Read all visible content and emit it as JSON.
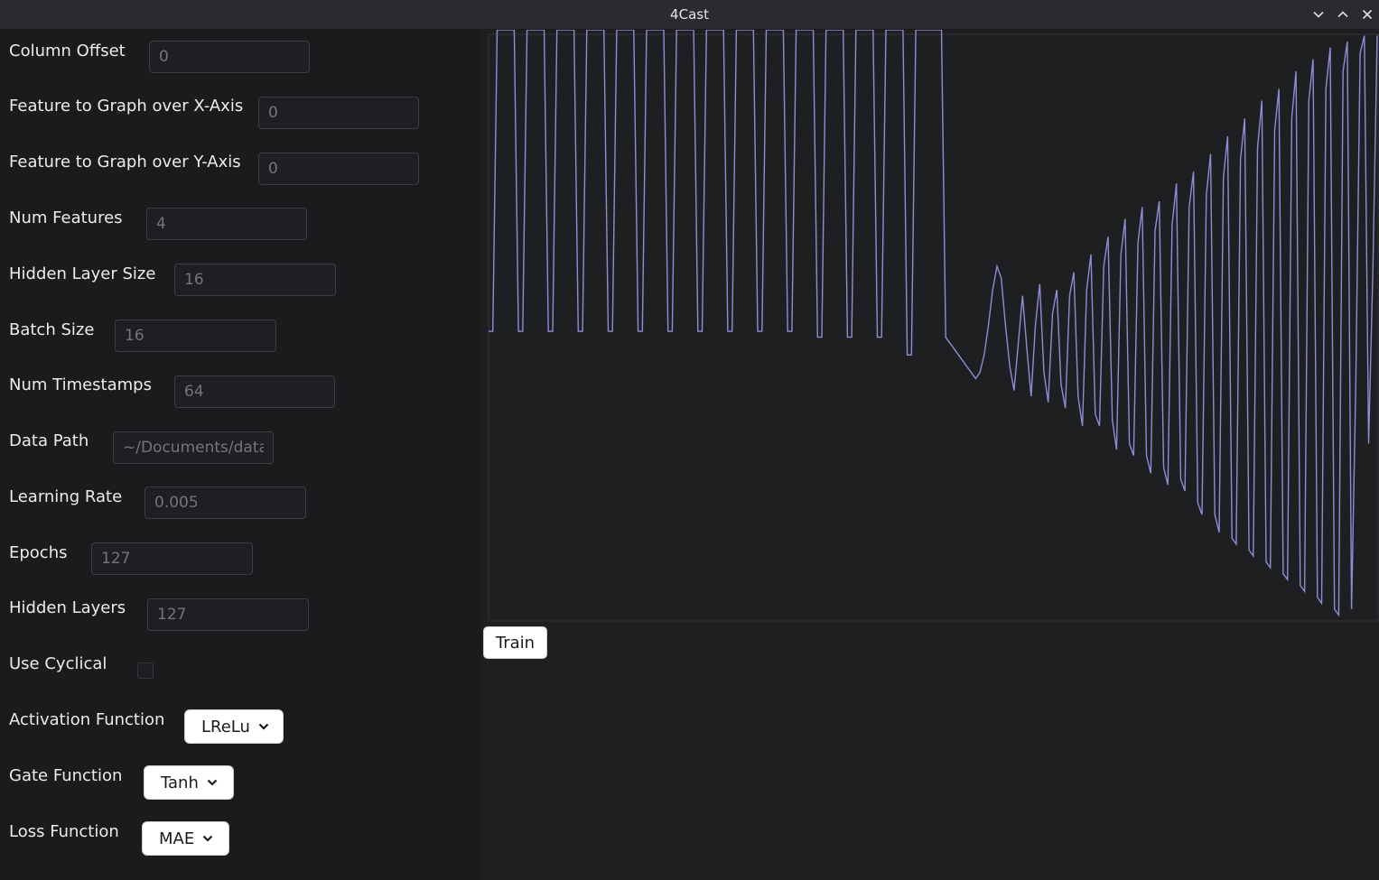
{
  "window": {
    "title": "4Cast"
  },
  "form": {
    "column_offset": {
      "label": "Column Offset",
      "placeholder": "0"
    },
    "feature_x": {
      "label": "Feature to Graph over X-Axis",
      "placeholder": "0"
    },
    "feature_y": {
      "label": "Feature to Graph over Y-Axis",
      "placeholder": "0"
    },
    "num_features": {
      "label": "Num Features",
      "placeholder": "4"
    },
    "hidden_layer_size": {
      "label": "Hidden Layer Size",
      "placeholder": "16"
    },
    "batch_size": {
      "label": "Batch Size",
      "placeholder": "16"
    },
    "num_timestamps": {
      "label": "Num Timestamps",
      "placeholder": "64"
    },
    "data_path": {
      "label": "Data Path",
      "placeholder": "~/Documents/data."
    },
    "learning_rate": {
      "label": "Learning Rate",
      "placeholder": "0.005"
    },
    "epochs": {
      "label": "Epochs",
      "placeholder": "127"
    },
    "hidden_layers": {
      "label": "Hidden Layers",
      "placeholder": "127"
    },
    "use_cyclical": {
      "label": "Use Cyclical",
      "checked": false
    },
    "activation_function": {
      "label": "Activation Function",
      "value": "LReLu"
    },
    "gate_function": {
      "label": "Gate Function",
      "value": "Tanh"
    },
    "loss_function": {
      "label": "Loss Function",
      "value": "MAE"
    }
  },
  "actions": {
    "train_label": "Train"
  },
  "colors": {
    "line": "#8f8cd6",
    "frame": "#2c2d31"
  },
  "chart_data": {
    "type": "line",
    "title": "",
    "xlabel": "",
    "ylabel": "",
    "grid": false,
    "legend": false,
    "xlim": [
      0,
      260
    ],
    "ylim": [
      0,
      1
    ],
    "series": [
      {
        "values": [
          0.49,
          0.49,
          1.0,
          1.0,
          1.0,
          1.0,
          1.0,
          0.49,
          0.49,
          1.0,
          1.0,
          1.0,
          1.0,
          1.0,
          0.49,
          0.49,
          1.0,
          1.0,
          1.0,
          1.0,
          1.0,
          0.49,
          0.49,
          1.0,
          1.0,
          1.0,
          1.0,
          1.0,
          0.49,
          0.49,
          1.0,
          1.0,
          1.0,
          1.0,
          1.0,
          0.49,
          0.49,
          1.0,
          1.0,
          1.0,
          1.0,
          1.0,
          0.49,
          0.49,
          1.0,
          1.0,
          1.0,
          1.0,
          1.0,
          0.49,
          0.49,
          1.0,
          1.0,
          1.0,
          1.0,
          1.0,
          0.49,
          0.49,
          1.0,
          1.0,
          1.0,
          1.0,
          1.0,
          0.49,
          0.49,
          1.0,
          1.0,
          1.0,
          1.0,
          1.0,
          0.49,
          0.49,
          1.0,
          1.0,
          1.0,
          1.0,
          1.0,
          0.48,
          0.48,
          1.0,
          1.0,
          1.0,
          1.0,
          1.0,
          0.48,
          0.48,
          1.0,
          1.0,
          1.0,
          1.0,
          1.0,
          0.48,
          0.48,
          1.0,
          1.0,
          1.0,
          1.0,
          1.0,
          0.45,
          0.45,
          1.0,
          1.0,
          1.0,
          1.0,
          1.0,
          1.0,
          1.0,
          0.48,
          0.47,
          0.46,
          0.45,
          0.44,
          0.43,
          0.42,
          0.41,
          0.42,
          0.45,
          0.5,
          0.56,
          0.6,
          0.58,
          0.5,
          0.43,
          0.39,
          0.47,
          0.55,
          0.46,
          0.38,
          0.5,
          0.57,
          0.42,
          0.37,
          0.52,
          0.56,
          0.4,
          0.36,
          0.55,
          0.59,
          0.38,
          0.33,
          0.56,
          0.62,
          0.35,
          0.33,
          0.6,
          0.65,
          0.34,
          0.29,
          0.62,
          0.68,
          0.3,
          0.28,
          0.64,
          0.7,
          0.28,
          0.25,
          0.66,
          0.71,
          0.26,
          0.23,
          0.67,
          0.74,
          0.24,
          0.22,
          0.7,
          0.76,
          0.2,
          0.18,
          0.72,
          0.79,
          0.18,
          0.15,
          0.75,
          0.82,
          0.14,
          0.13,
          0.78,
          0.85,
          0.12,
          0.11,
          0.8,
          0.88,
          0.1,
          0.09,
          0.83,
          0.9,
          0.08,
          0.07,
          0.85,
          0.93,
          0.06,
          0.05,
          0.88,
          0.95,
          0.04,
          0.03,
          0.9,
          0.97,
          0.02,
          0.01,
          0.93,
          0.98,
          0.02,
          0.4,
          0.96,
          0.99,
          0.3,
          0.6,
          0.99
        ]
      }
    ]
  }
}
